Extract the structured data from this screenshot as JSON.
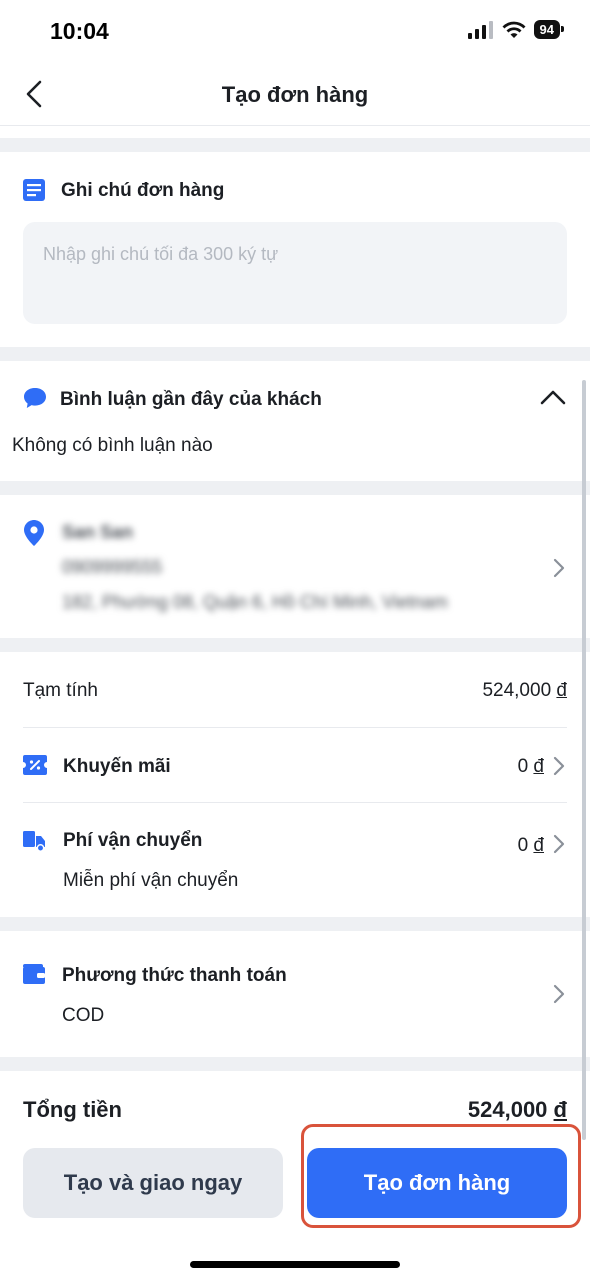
{
  "status_bar": {
    "time": "10:04",
    "battery": "94"
  },
  "header": {
    "title": "Tạo đơn hàng",
    "back_icon": "chevron-left-icon"
  },
  "note_section": {
    "title": "Ghi chú đơn hàng",
    "placeholder": "Nhập ghi chú tối đa 300 ký tự",
    "icon": "note-icon"
  },
  "comments_section": {
    "title": "Bình luận gần đây của khách",
    "empty_text": "Không có bình luận nào",
    "icon": "chat-bubble-icon",
    "toggle_icon": "chevron-up-icon"
  },
  "address_section": {
    "name": "San San",
    "phone": "0909999555",
    "address": "182, Phường 08, Quận 6, Hồ Chí Minh, Vietnam",
    "icon": "location-pin-icon"
  },
  "summary": {
    "subtotal_label": "Tạm tính",
    "subtotal_value": "524,000",
    "currency": "đ",
    "promo_label": "Khuyến mãi",
    "promo_value": "0",
    "shipping_label": "Phí vận chuyển",
    "shipping_value": "0",
    "shipping_note": "Miễn phí vận chuyển"
  },
  "payment": {
    "label": "Phương thức thanh toán",
    "method": "COD",
    "icon": "wallet-icon"
  },
  "total": {
    "label": "Tổng tiền",
    "value": "524,000"
  },
  "buttons": {
    "secondary": "Tạo và giao ngay",
    "primary": "Tạo đơn hàng"
  },
  "colors": {
    "accent": "#2f6df6",
    "highlight": "#d9533b",
    "background_gap": "#eef0f3"
  }
}
